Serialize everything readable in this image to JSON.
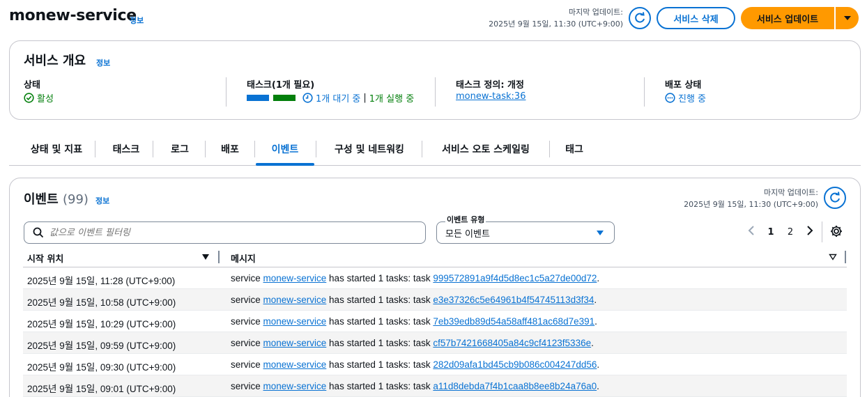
{
  "header": {
    "service_name": "monew-service",
    "info_label": "정보",
    "last_updated_label": "마지막 업데이트:",
    "last_updated_value": "2025년 9월 15일, 11:30 (UTC+9:00)",
    "delete_label": "서비스 삭제",
    "update_label": "서비스 업데이트"
  },
  "overview": {
    "title": "서비스 개요",
    "info_label": "정보",
    "status": {
      "label": "상태",
      "value": "활성"
    },
    "tasks": {
      "label": "태스크(1개 필요)",
      "pending": "1개 대기 중",
      "separator": "|",
      "running": "1개 실행 중"
    },
    "task_def": {
      "label": "태스크 정의: 개정",
      "value": "monew-task:36"
    },
    "deployment": {
      "label": "배포 상태",
      "value": "진행 중"
    }
  },
  "tabs": [
    {
      "label": "상태 및 지표"
    },
    {
      "label": "태스크"
    },
    {
      "label": "로그"
    },
    {
      "label": "배포"
    },
    {
      "label": "이벤트"
    },
    {
      "label": "구성 및 네트워킹"
    },
    {
      "label": "서비스 오토 스케일링"
    },
    {
      "label": "태그"
    }
  ],
  "events": {
    "title": "이벤트",
    "count": "(99)",
    "info_label": "정보",
    "last_updated_label": "마지막 업데이트:",
    "last_updated_value": "2025년 9월 15일, 11:30 (UTC+9:00)",
    "search_placeholder": "값으로 이벤트 필터링",
    "type_label": "이벤트 유형",
    "type_value": "모든 이벤트",
    "pages": [
      "1",
      "2"
    ],
    "columns": {
      "start": "시작 위치",
      "message": "메시지"
    },
    "rows": [
      {
        "time": "2025년 9월 15일, 11:28 (UTC+9:00)",
        "prefix": "service ",
        "service": "monew-service",
        "middle": " has started 1 tasks: task ",
        "task": "999572891a9f4d5d8ec1c5a27de00d72",
        "suffix": "."
      },
      {
        "time": "2025년 9월 15일, 10:58 (UTC+9:00)",
        "prefix": "service ",
        "service": "monew-service",
        "middle": " has started 1 tasks: task ",
        "task": "e3e37326c5e64961b4f54745113d3f34",
        "suffix": "."
      },
      {
        "time": "2025년 9월 15일, 10:29 (UTC+9:00)",
        "prefix": "service ",
        "service": "monew-service",
        "middle": " has started 1 tasks: task ",
        "task": "7eb39edb89d54a58aff481ac68d7e391",
        "suffix": "."
      },
      {
        "time": "2025년 9월 15일, 09:59 (UTC+9:00)",
        "prefix": "service ",
        "service": "monew-service",
        "middle": " has started 1 tasks: task ",
        "task": "cf57b7421668405a84c9cf4123f5336e",
        "suffix": "."
      },
      {
        "time": "2025년 9월 15일, 09:30 (UTC+9:00)",
        "prefix": "service ",
        "service": "monew-service",
        "middle": " has started 1 tasks: task ",
        "task": "282d09afa1bd45cb9b086c004247dd56",
        "suffix": "."
      },
      {
        "time": "2025년 9월 15일, 09:01 (UTC+9:00)",
        "prefix": "service ",
        "service": "monew-service",
        "middle": " has started 1 tasks: task ",
        "task": "a11d8debda7f4b1caa8b8ee8b24a76a0",
        "suffix": "."
      }
    ]
  },
  "colors": {
    "accent": "#0972d3",
    "primary": "#ff9900",
    "success": "#037f0c"
  }
}
